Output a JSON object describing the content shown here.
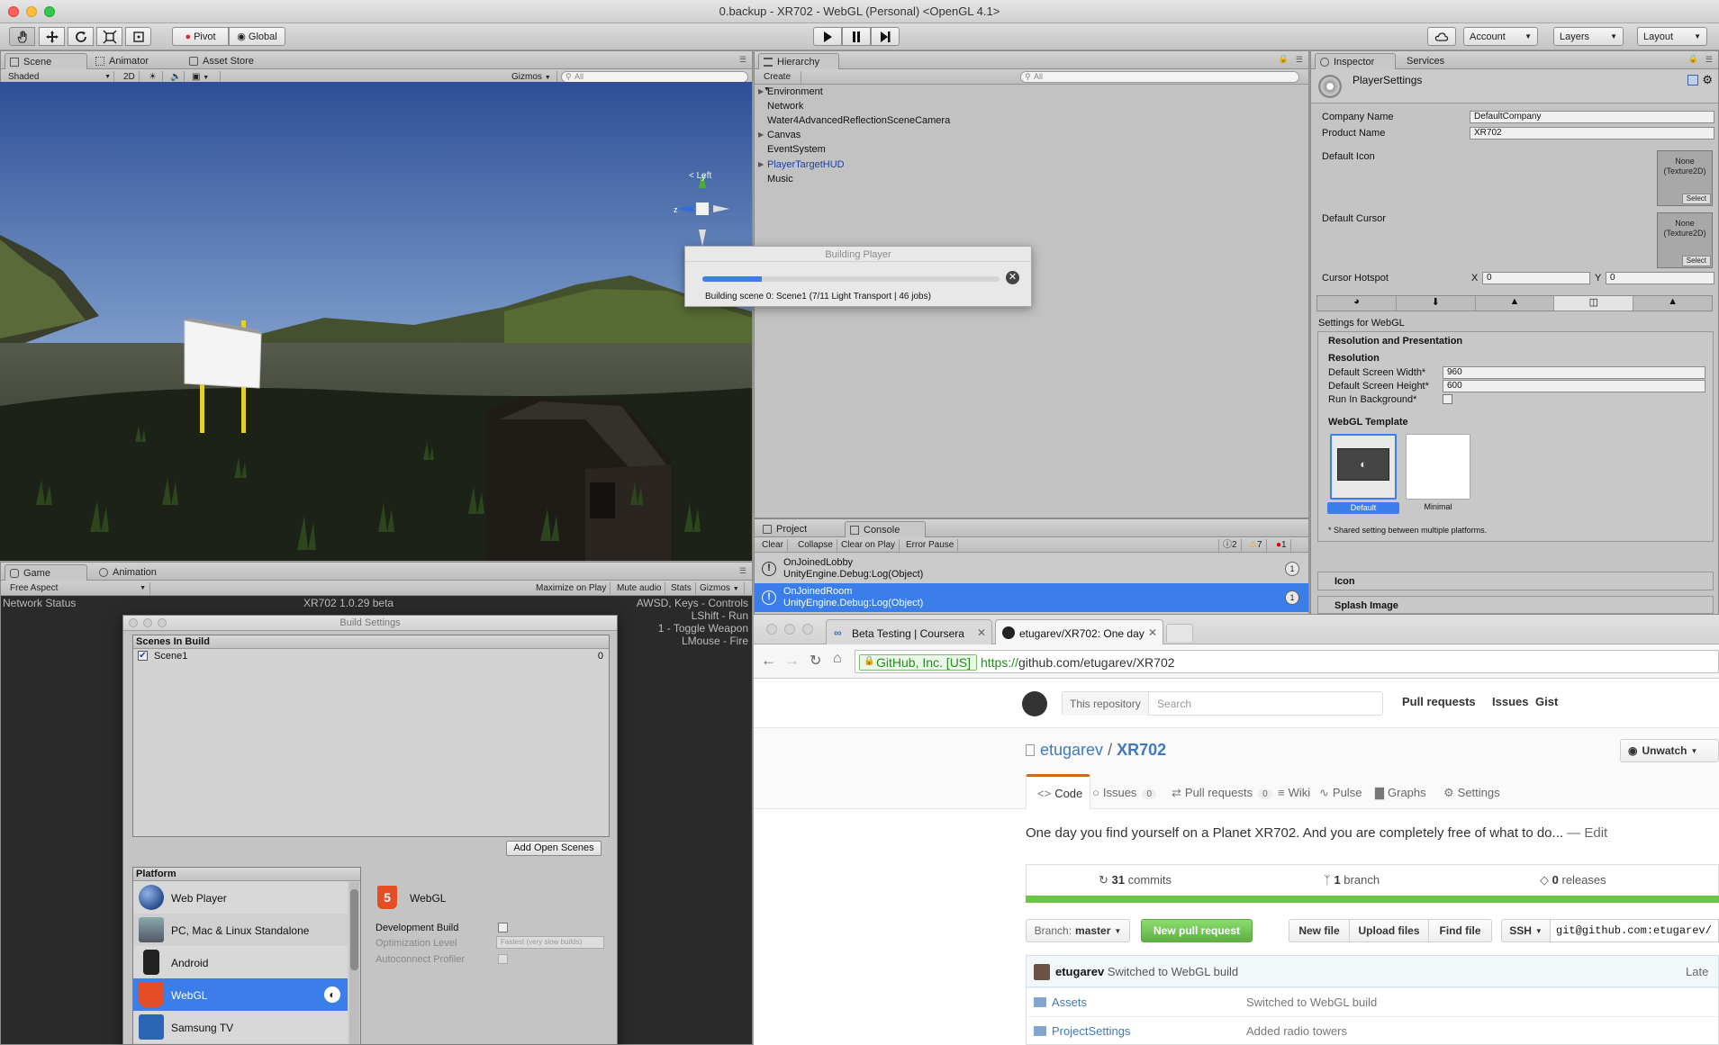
{
  "window": {
    "title": "0.backup - XR702 - WebGL (Personal) <OpenGL 4.1>"
  },
  "toolbar": {
    "pivot_label": "Pivot",
    "global_label": "Global",
    "account_label": "Account",
    "layers_label": "Layers",
    "layout_label": "Layout"
  },
  "scene": {
    "tabs": [
      "Scene",
      "Animator",
      "Asset Store"
    ],
    "shading": "Shaded",
    "mode_2d": "2D",
    "gizmos": "Gizmos",
    "search_placeholder": "All",
    "orientation": "Left"
  },
  "game": {
    "tabs": [
      "Game",
      "Animation"
    ],
    "aspect": "Free Aspect",
    "options": [
      "Maximize on Play",
      "Mute audio",
      "Stats",
      "Gizmos"
    ],
    "network_status": "Network Status",
    "version": "XR702 1.0.29 beta",
    "controls": [
      "AWSD, Keys - Controls",
      "LShift - Run",
      "1 - Toggle Weapon",
      "LMouse - Fire"
    ]
  },
  "hierarchy": {
    "tab": "Hierarchy",
    "create": "Create",
    "search_placeholder": "All",
    "items": [
      {
        "label": "Environment",
        "expandable": true,
        "highlight": false
      },
      {
        "label": "Network",
        "expandable": false,
        "highlight": false
      },
      {
        "label": "Water4AdvancedReflectionSceneCamera",
        "expandable": false,
        "highlight": false
      },
      {
        "label": "Canvas",
        "expandable": true,
        "highlight": false
      },
      {
        "label": "EventSystem",
        "expandable": false,
        "highlight": false
      },
      {
        "label": "PlayerTargetHUD",
        "expandable": true,
        "highlight": true
      },
      {
        "label": "Music",
        "expandable": false,
        "highlight": false
      }
    ]
  },
  "build_progress": {
    "title": "Building Player",
    "status": "Building scene 0: Scene1 (7/11 Light Transport | 46 jobs)",
    "progress": 0.2
  },
  "console": {
    "tabs": [
      "Project",
      "Console"
    ],
    "buttons": [
      "Clear",
      "Collapse",
      "Clear on Play",
      "Error Pause"
    ],
    "counts": {
      "info": "2",
      "warnings": "7",
      "errors": "1"
    },
    "entries": [
      {
        "line1": "OnJoinedLobby",
        "line2": "UnityEngine.Debug:Log(Object)",
        "count": "1",
        "selected": false
      },
      {
        "line1": "OnJoinedRoom",
        "line2": "UnityEngine.Debug:Log(Object)",
        "count": "1",
        "selected": true
      }
    ]
  },
  "inspector": {
    "tabs": [
      "Inspector",
      "Services"
    ],
    "object_name": "PlayerSettings",
    "company_label": "Company Name",
    "company_value": "DefaultCompany",
    "product_label": "Product Name",
    "product_value": "XR702",
    "default_icon_label": "Default Icon",
    "default_cursor_label": "Default Cursor",
    "texture_none": "None",
    "texture_type": "(Texture2D)",
    "select_label": "Select",
    "hotspot_label": "Cursor Hotspot",
    "hotspot_x_label": "X",
    "hotspot_x": "0",
    "hotspot_y_label": "Y",
    "hotspot_y": "0",
    "settings_for": "Settings for WebGL",
    "res_section": "Resolution and Presentation",
    "resolution_label": "Resolution",
    "width_label": "Default Screen Width*",
    "width_value": "960",
    "height_label": "Default Screen Height*",
    "height_value": "600",
    "run_bg_label": "Run In Background*",
    "template_label": "WebGL Template",
    "template_default": "Default",
    "template_minimal": "Minimal",
    "shared_note": "* Shared setting between multiple platforms.",
    "icon_section": "Icon",
    "splash_section": "Splash Image"
  },
  "build_settings": {
    "title": "Build Settings",
    "scenes_header": "Scenes In Build",
    "scenes": [
      {
        "name": "Scene1",
        "index": "0",
        "checked": true
      }
    ],
    "add_open_scenes": "Add Open Scenes",
    "platform_header": "Platform",
    "platforms": [
      "Web Player",
      "PC, Mac & Linux Standalone",
      "Android",
      "WebGL",
      "Samsung TV"
    ],
    "selected_platform": "WebGL",
    "detail_title": "WebGL",
    "dev_build": "Development Build",
    "optimization": "Optimization Level",
    "optimization_value": "Fastest (very slow builds)",
    "autoconnect": "Autoconnect Profiler"
  },
  "browser": {
    "tabs": [
      "Beta Testing | Coursera",
      "etugarev/XR702: One day"
    ],
    "cert": "GitHub, Inc. [US]",
    "url_scheme": "https://",
    "url_rest": "github.com/etugarev/XR702",
    "this_repo": "This repository",
    "search_placeholder": "Search",
    "nav": [
      "Pull requests",
      "Issues",
      "Gist"
    ],
    "owner": "etugarev",
    "separator": "/",
    "repo": "XR702",
    "unwatch": "Unwatch",
    "repo_tabs": [
      {
        "label": "Code",
        "count": ""
      },
      {
        "label": "Issues",
        "count": "0"
      },
      {
        "label": "Pull requests",
        "count": "0"
      },
      {
        "label": "Wiki",
        "count": ""
      },
      {
        "label": "Pulse",
        "count": ""
      },
      {
        "label": "Graphs",
        "count": ""
      },
      {
        "label": "Settings",
        "count": ""
      }
    ],
    "description": "One day you find yourself on a Planet XR702. And you are completely free of what to do...",
    "edit": "— Edit",
    "commits_num": "31",
    "commits_label": "commits",
    "branches_num": "1",
    "branches_label": "branch",
    "releases_num": "0",
    "releases_label": "releases",
    "branch_prefix": "Branch:",
    "branch_name": "master",
    "new_pr": "New pull request",
    "new_file": "New file",
    "upload_files": "Upload files",
    "find_file": "Find file",
    "ssh": "SSH",
    "clone_url": "git@github.com:etugarev/",
    "latest_author": "etugarev",
    "latest_msg": "Switched to WebGL build",
    "latest_label": "Late",
    "files": [
      {
        "name": "Assets",
        "message": "Switched to WebGL build"
      },
      {
        "name": "ProjectSettings",
        "message": "Added radio towers"
      }
    ]
  },
  "colors": {
    "accent": "#3b7de9",
    "github_green": "#6cc644",
    "link": "#4078c0"
  }
}
